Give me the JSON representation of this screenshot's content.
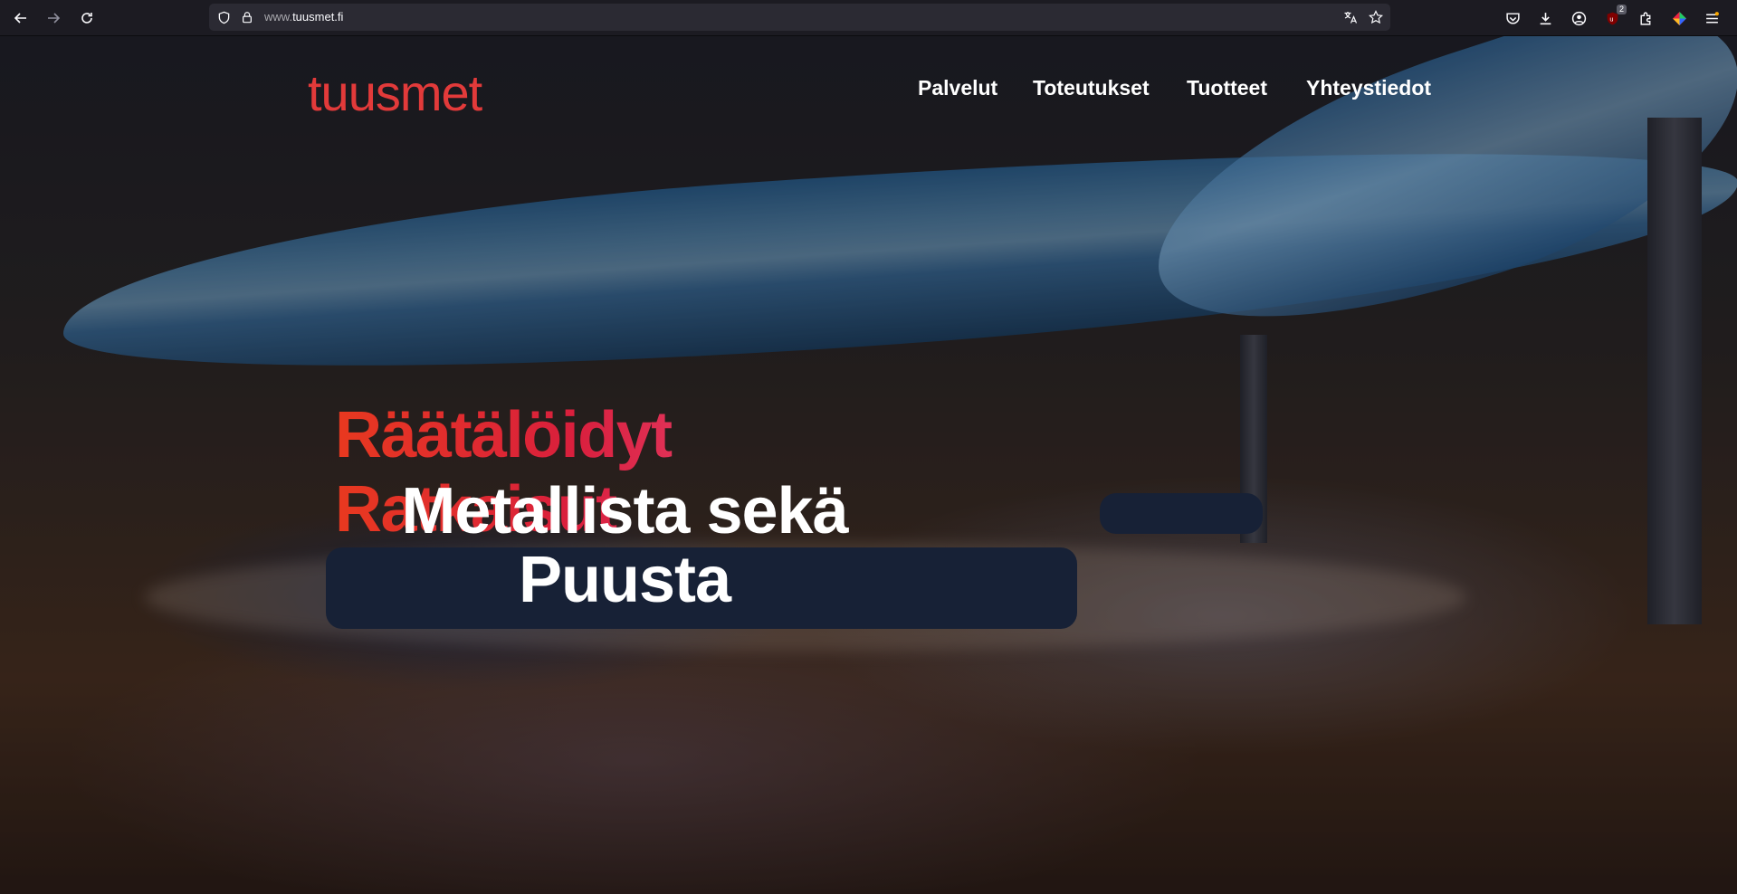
{
  "browser": {
    "url_prefix": "www.",
    "url_domain": "tuusmet.fi",
    "extension_badge": "2",
    "icons": {
      "back": "arrow-left-icon",
      "forward": "arrow-right-icon",
      "reload": "reload-icon",
      "shield": "shield-icon",
      "lock": "lock-icon",
      "translate": "translate-icon",
      "bookmark": "star-icon",
      "pocket": "pocket-icon",
      "downloads": "download-icon",
      "account": "account-icon",
      "ublock": "ublock-icon",
      "extensions": "puzzle-icon",
      "color": "color-wheel-icon",
      "menu": "hamburger-menu-icon"
    }
  },
  "site": {
    "logo": "tuusmet",
    "nav": [
      "Palvelut",
      "Toteutukset",
      "Tuotteet",
      "Yhteystiedot"
    ]
  },
  "hero": {
    "title": "Räätälöidyt Ratkaisut",
    "subtitle_line1": "Metallista sekä",
    "subtitle_line2": "Puusta"
  },
  "colors": {
    "brand_red": "#e23a3a",
    "title_gradient_start": "#e8391f",
    "title_gradient_end": "#f0576e",
    "chrome_bg": "#1c1b22",
    "urlbar_bg": "#2b2a33"
  }
}
